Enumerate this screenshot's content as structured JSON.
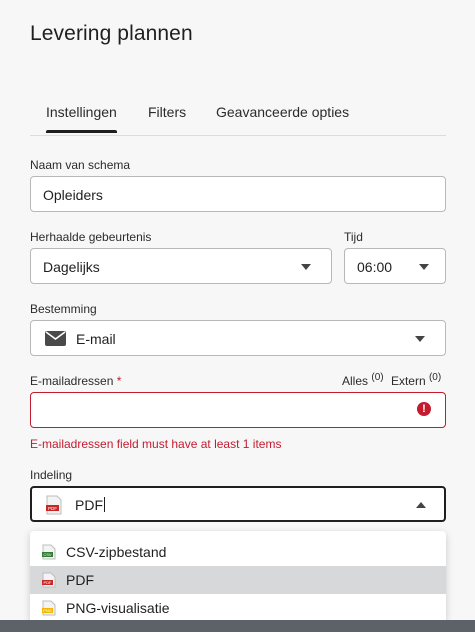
{
  "dialog": {
    "title": "Levering plannen"
  },
  "tabs": [
    {
      "label": "Instellingen",
      "active": true
    },
    {
      "label": "Filters",
      "active": false
    },
    {
      "label": "Geavanceerde opties",
      "active": false
    }
  ],
  "schedule_name": {
    "label": "Naam van schema",
    "value": "Opleiders"
  },
  "recurrence": {
    "label": "Herhaalde gebeurtenis",
    "value": "Dagelijks"
  },
  "time": {
    "label": "Tijd",
    "value": "06:00"
  },
  "destination": {
    "label": "Bestemming",
    "value": "E-mail",
    "icon": "envelope-icon"
  },
  "emails": {
    "label": "E-mailadressen",
    "required_mark": "*",
    "all_label": "Alles",
    "all_count": "(0)",
    "external_label": "Extern",
    "external_count": "(0)",
    "value": "",
    "error_icon": "!",
    "error_message": "E-mailadressen field must have at least 1 items"
  },
  "format": {
    "label": "Indeling",
    "value": "PDF",
    "icon": "pdf-file-icon",
    "options": [
      {
        "label": "CSV-zipbestand",
        "icon": "csv-file-icon",
        "badge": "CSV",
        "color": "#2e7d32",
        "selected": false
      },
      {
        "label": "PDF",
        "icon": "pdf-file-icon",
        "badge": "PDF",
        "color": "#c62828",
        "selected": true
      },
      {
        "label": "PNG-visualisatie",
        "icon": "png-file-icon",
        "badge": "PNG",
        "color": "#f2b705",
        "selected": false
      }
    ]
  },
  "colors": {
    "error": "#c31c2f",
    "selected_row": "#d7d8da"
  }
}
